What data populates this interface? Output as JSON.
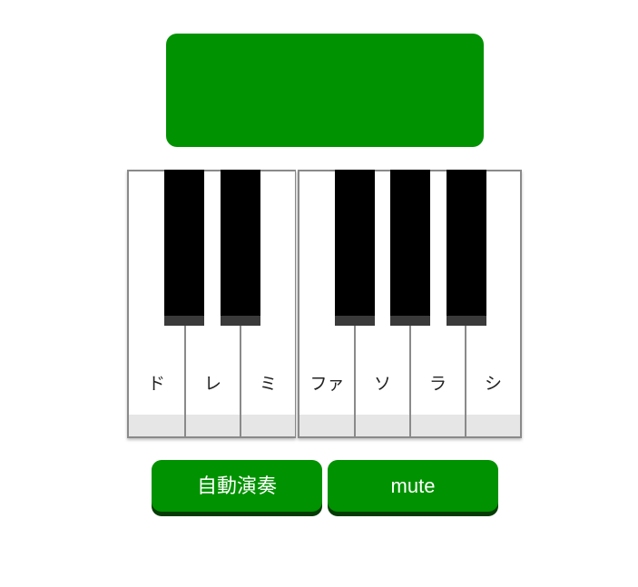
{
  "colors": {
    "accent": "#009200",
    "button_shadow": "#053b05",
    "black_key": "#000000",
    "black_key_edge": "#3a3a3a",
    "white_key_footer": "#e6e6e6",
    "key_border": "#8a8a8a"
  },
  "piano": {
    "left_octave": {
      "white_keys": [
        "ド",
        "レ",
        "ミ"
      ]
    },
    "right_octave": {
      "white_keys": [
        "ファ",
        "ソ",
        "ラ",
        "シ"
      ]
    }
  },
  "buttons": {
    "auto_play_label": "自動演奏",
    "mute_label": "mute"
  }
}
